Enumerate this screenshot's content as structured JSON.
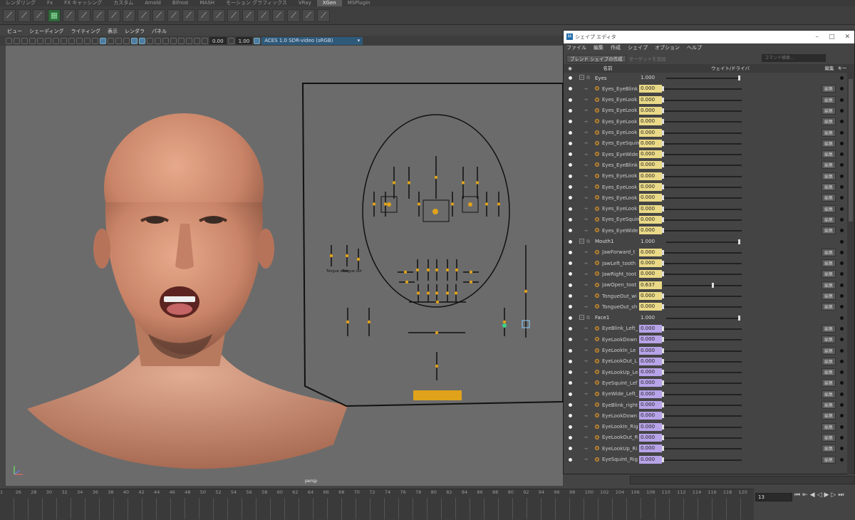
{
  "shelf_tabs": [
    "レンダリング",
    "Fx",
    "FX キャッシング",
    "カスタム",
    "Arnold",
    "Bifrost",
    "MASH",
    "モーション グラフィックス",
    "VRay",
    "XGen",
    "MSPlugin"
  ],
  "active_shelf": "XGen",
  "viewport_menu": [
    "ビュー",
    "シェーディング",
    "ライティング",
    "表示",
    "レンダラ",
    "パネル"
  ],
  "viewport_toolbar": {
    "exposure": "0.00",
    "gamma": "1.00",
    "color_space": "ACES 1.0 SDR-video (sRGB)"
  },
  "viewport_label": "persp",
  "shape_editor": {
    "title": "シェイプ エディタ",
    "menu": [
      "ファイル",
      "編集",
      "作成",
      "シェイプ",
      "オプション",
      "ヘルプ"
    ],
    "create_blend_button": "ブレンド シェイプの作成",
    "add_target_button": "ターゲットを追加",
    "search_placeholder": "コマンド検索...",
    "col_name": "名前",
    "col_weight": "ウェイト/ドライバ",
    "col_edit": "編集",
    "col_key": "キー",
    "edit_label": "編集",
    "groups": [
      {
        "name": "Eyes",
        "value": "1.000",
        "targets": [
          {
            "name": "Eyes_EyeBlink",
            "value": "0.000"
          },
          {
            "name": "Eyes_EyeLook",
            "value": "0.000"
          },
          {
            "name": "Eyes_EyeLook",
            "value": "0.000"
          },
          {
            "name": "Eyes_EyeLook",
            "value": "0.000"
          },
          {
            "name": "Eyes_EyeLook",
            "value": "0.000"
          },
          {
            "name": "Eyes_EyeSquin",
            "value": "0.000"
          },
          {
            "name": "Eyes_EyeWide",
            "value": "0.000"
          },
          {
            "name": "Eyes_EyeBlink",
            "value": "0.000"
          },
          {
            "name": "Eyes_EyeLook",
            "value": "0.000"
          },
          {
            "name": "Eyes_EyeLook",
            "value": "0.000"
          },
          {
            "name": "Eyes_EyeLook",
            "value": "0.000"
          },
          {
            "name": "Eyes_EyeLook",
            "value": "0.000"
          },
          {
            "name": "Eyes_EyeSquin",
            "value": "0.000"
          },
          {
            "name": "Eyes_EyeWide",
            "value": "0.000"
          }
        ]
      },
      {
        "name": "Mouth1",
        "value": "1.000",
        "targets": [
          {
            "name": "JawForward_t",
            "value": "0.000"
          },
          {
            "name": "JawLeft_tooth",
            "value": "0.000"
          },
          {
            "name": "JawRight_toot",
            "value": "0.000"
          },
          {
            "name": "JawOpen_toot",
            "value": "0.637"
          },
          {
            "name": "TongueOut_wi",
            "value": "0.000"
          },
          {
            "name": "TongueOut_sh",
            "value": "0.000"
          }
        ]
      },
      {
        "name": "Face1",
        "value": "1.000",
        "targets": [
          {
            "name": "EyeBlink_Left_",
            "value": "0.000"
          },
          {
            "name": "EyeLookDown",
            "value": "0.000"
          },
          {
            "name": "EyeLookIn_Le",
            "value": "0.000"
          },
          {
            "name": "EyeLookOut_L",
            "value": "0.000"
          },
          {
            "name": "EyeLookUp_Le",
            "value": "0.000"
          },
          {
            "name": "EyeSquint_Lef",
            "value": "0.000"
          },
          {
            "name": "EyeWide_Left_",
            "value": "0.000"
          },
          {
            "name": "EyeBlink_right",
            "value": "0.000"
          },
          {
            "name": "EyeLookDown",
            "value": "0.000"
          },
          {
            "name": "EyeLookIn_Rig",
            "value": "0.000"
          },
          {
            "name": "EyeLookOut_R",
            "value": "0.000"
          },
          {
            "name": "EyeLookUp_Ri",
            "value": "0.000"
          },
          {
            "name": "EyeSquint_Rig",
            "value": "0.000"
          }
        ]
      }
    ]
  },
  "rig_labels": {
    "tongue_wide": "Tongue wide",
    "tongue_out": "Tongue out"
  },
  "timeline_ticks": [
    "1",
    "26",
    "28",
    "30",
    "32",
    "34",
    "36",
    "38",
    "40",
    "42",
    "44",
    "46",
    "48",
    "50",
    "52",
    "54",
    "56",
    "58",
    "60",
    "62",
    "64",
    "66",
    "68",
    "70",
    "72",
    "74",
    "76",
    "78",
    "80",
    "82",
    "84",
    "86",
    "88",
    "90",
    "92",
    "94",
    "96",
    "98",
    "100",
    "102",
    "104",
    "106",
    "108",
    "110",
    "112",
    "114",
    "116",
    "118",
    "120"
  ],
  "current_frame": "13",
  "colors": {
    "yellow_value": "#ead987",
    "purple_value": "#b7a3e8",
    "rig_orange": "#e0a21a"
  }
}
